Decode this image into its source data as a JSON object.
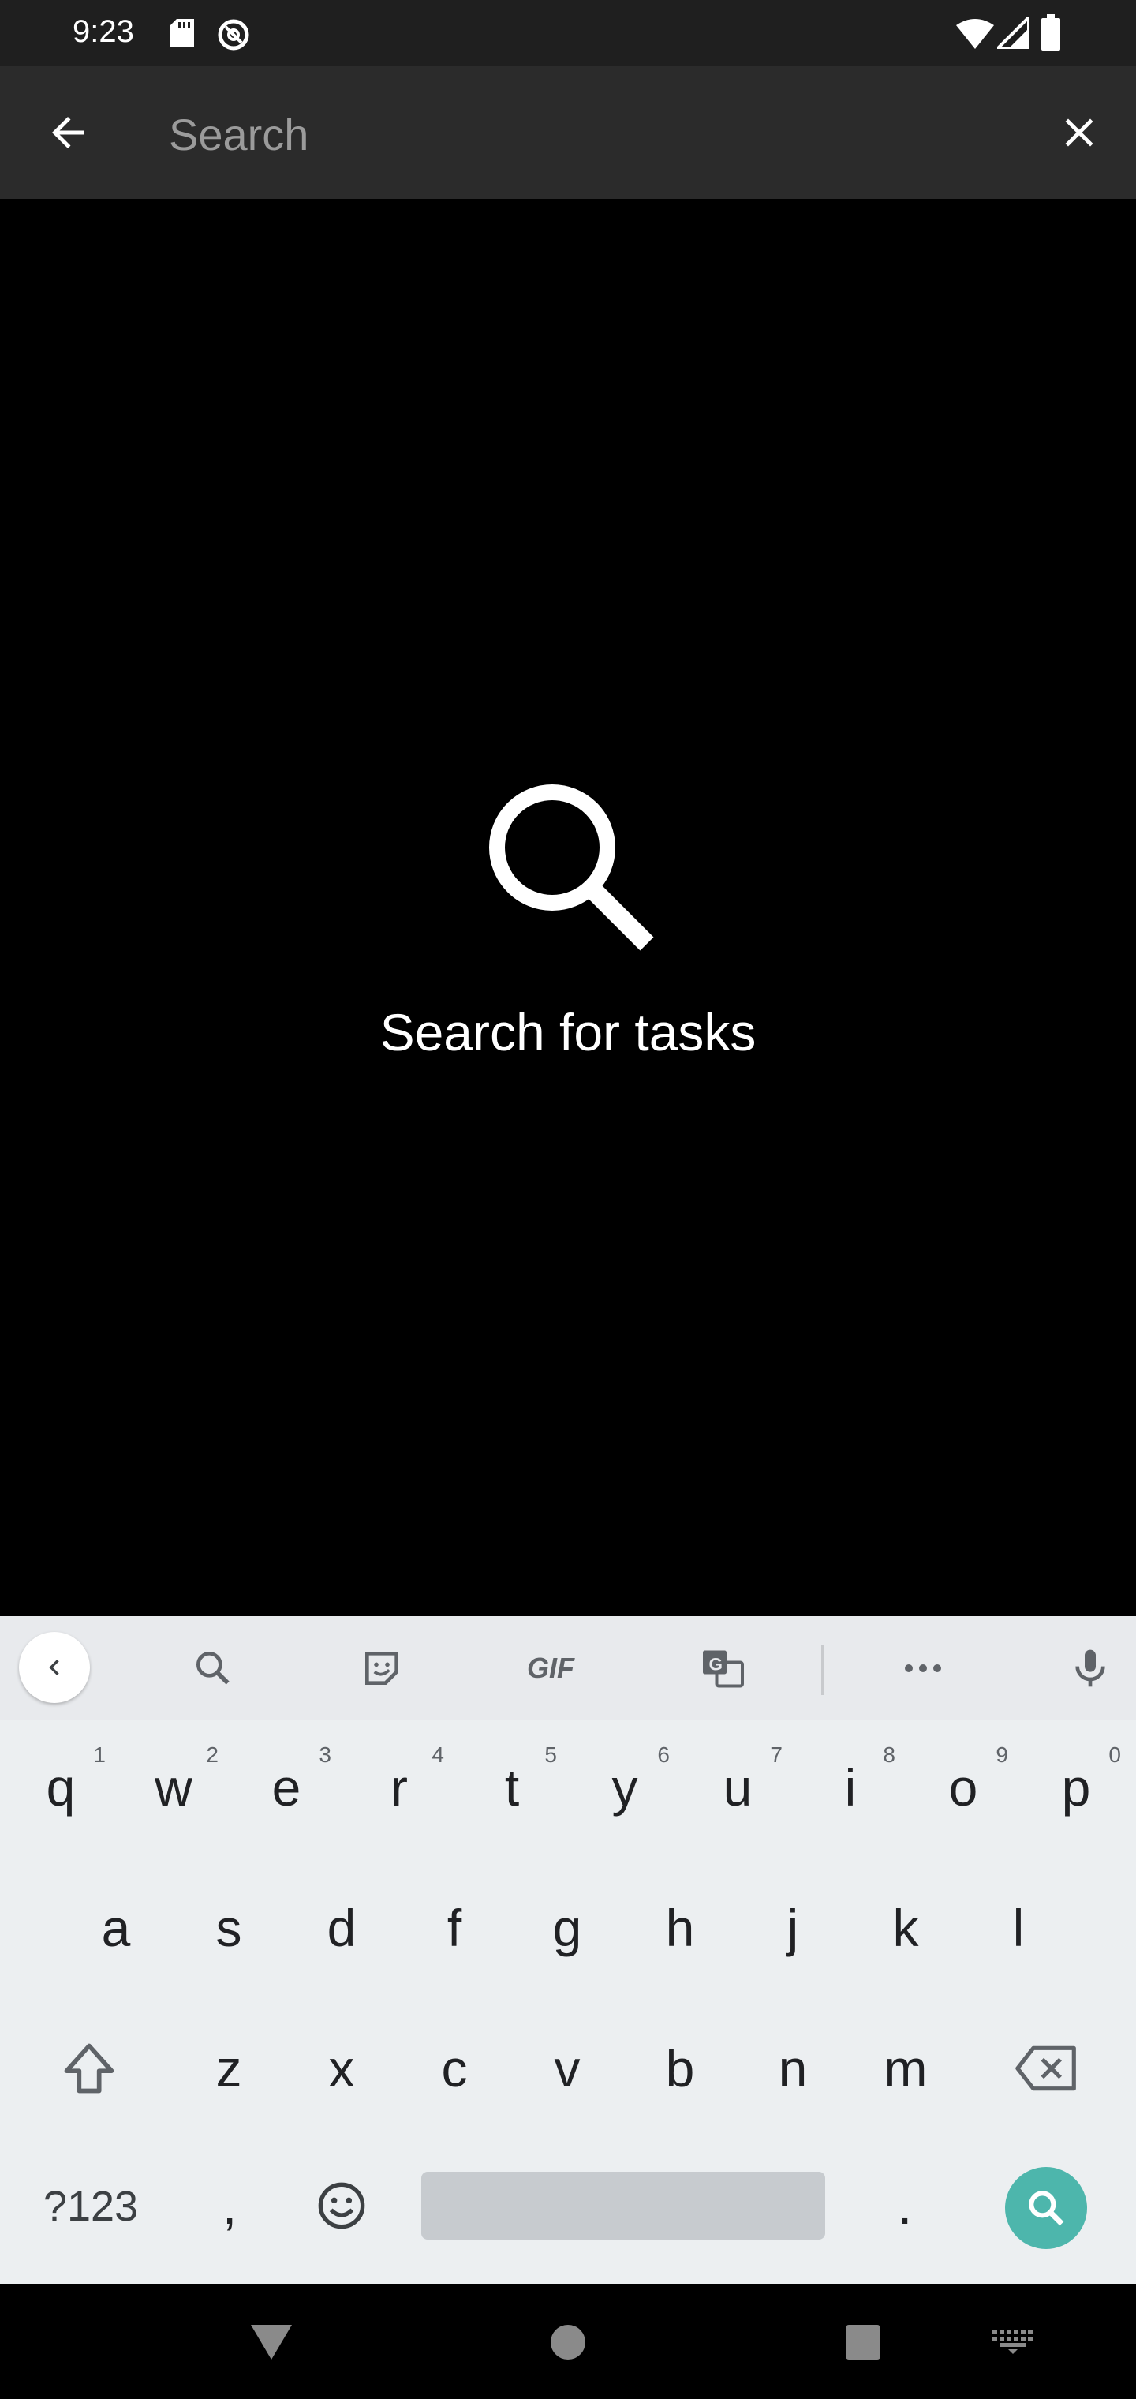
{
  "status_bar": {
    "time": "9:23",
    "icons": [
      "sd-card-icon",
      "at-symbol-icon",
      "wifi-icon",
      "cell-signal-icon",
      "battery-icon"
    ]
  },
  "search_bar": {
    "placeholder": "Search",
    "value": "",
    "back_icon": "arrow-left-icon",
    "clear_icon": "close-icon"
  },
  "empty_state": {
    "icon": "search-icon",
    "message": "Search for tasks"
  },
  "keyboard": {
    "toolbar": [
      "chevron-left-icon",
      "search-icon",
      "sticker-icon",
      "GIF",
      "translate-icon",
      "more-icon",
      "mic-icon"
    ],
    "row1": [
      {
        "key": "q",
        "sup": "1"
      },
      {
        "key": "w",
        "sup": "2"
      },
      {
        "key": "e",
        "sup": "3"
      },
      {
        "key": "r",
        "sup": "4"
      },
      {
        "key": "t",
        "sup": "5"
      },
      {
        "key": "y",
        "sup": "6"
      },
      {
        "key": "u",
        "sup": "7"
      },
      {
        "key": "i",
        "sup": "8"
      },
      {
        "key": "o",
        "sup": "9"
      },
      {
        "key": "p",
        "sup": "0"
      }
    ],
    "row2": [
      "a",
      "s",
      "d",
      "f",
      "g",
      "h",
      "j",
      "k",
      "l"
    ],
    "row3": [
      "z",
      "x",
      "c",
      "v",
      "b",
      "n",
      "m"
    ],
    "sym_label": "?123",
    "comma": ",",
    "period": ".",
    "accent_color": "#4db6ac"
  },
  "nav_bar": {
    "icons": [
      "back-triangle-icon",
      "home-circle-icon",
      "recents-square-icon",
      "keyboard-switch-icon"
    ]
  },
  "colors": {
    "status_bg": "#1f1f1f",
    "appbar_bg": "#2b2b2b",
    "content_bg": "#000000",
    "keyboard_bg": "#eceff1"
  }
}
